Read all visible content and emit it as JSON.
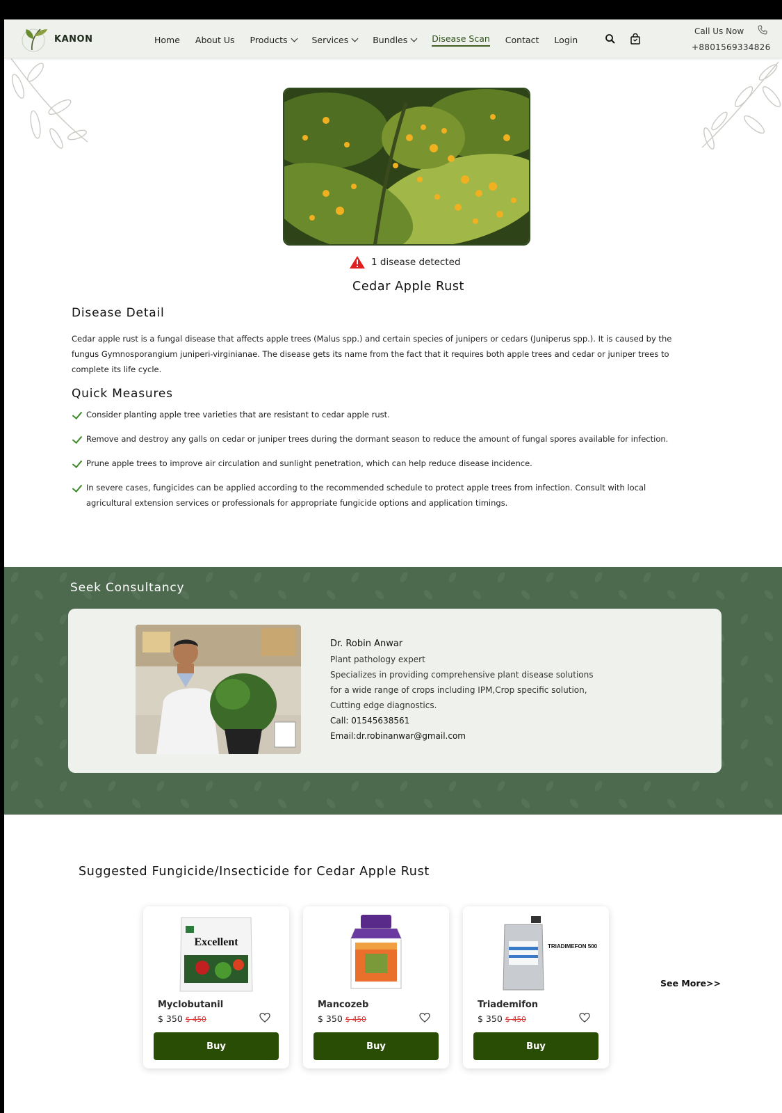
{
  "brand": {
    "name": "KANON"
  },
  "nav": {
    "items": [
      {
        "label": "Home"
      },
      {
        "label": "About Us"
      },
      {
        "label": "Products"
      },
      {
        "label": "Services"
      },
      {
        "label": "Bundles"
      },
      {
        "label": "Disease Scan"
      },
      {
        "label": "Contact"
      },
      {
        "label": "Login"
      }
    ],
    "active": "Disease Scan"
  },
  "header": {
    "call_label": "Call Us Now",
    "phone": "+8801569334826"
  },
  "scan": {
    "detected_text": "1 disease detected",
    "disease_name": "Cedar Apple Rust"
  },
  "detail": {
    "heading": "Disease Detail",
    "text": "Cedar apple rust is a fungal disease that affects apple trees (Malus spp.) and certain species of junipers or cedars (Juniperus spp.). It is caused by the fungus Gymnosporangium juniperi-virginianae. The disease gets its name from the fact that it requires both apple trees and cedar or juniper trees to complete its life cycle."
  },
  "measures": {
    "heading": "Quick Measures",
    "items": [
      "Consider planting apple tree varieties that are resistant to cedar apple rust.",
      "Remove and destroy any galls on cedar or juniper trees during the dormant season to reduce the amount of fungal spores available for infection.",
      "Prune apple trees to improve air circulation and sunlight penetration, which can help reduce disease incidence.",
      "In severe cases, fungicides can be applied according to the recommended schedule to protect apple trees from infection. Consult with local agricultural extension services or professionals for appropriate fungicide options and application timings."
    ]
  },
  "consultancy": {
    "heading": "Seek Consultancy",
    "name": "Dr. Robin Anwar",
    "role": "Plant pathology expert",
    "desc1": "Specializes in providing comprehensive plant disease solutions",
    "desc2": "for a wide range of crops including IPM,Crop specific solution,",
    "desc3": "Cutting edge diagnostics.",
    "call": "Call: 01545638561",
    "email": "Email:dr.robinanwar@gmail.com"
  },
  "suggested": {
    "heading": "Suggested Fungicide/Insecticide for Cedar Apple Rust",
    "products": [
      {
        "name": "Myclobutanil",
        "price": "$ 350",
        "old_price": "$ 450",
        "buy": "Buy",
        "package_text": "Excellent"
      },
      {
        "name": "Mancozeb",
        "price": "$ 350",
        "old_price": "$ 450",
        "buy": "Buy",
        "package_text": ""
      },
      {
        "name": "Triademifon",
        "price": "$ 350",
        "old_price": "$ 450",
        "buy": "Buy",
        "package_text": "TRIADIMEFON 500 WG"
      }
    ],
    "see_more": "See More>>"
  },
  "colors": {
    "brand_green": "#2a4d06",
    "consult_bg": "#4d6a4f",
    "header_bg": "#eef1ec",
    "check_green": "#3e8a2a",
    "warning_red": "#e02020"
  },
  "icons": [
    "search-icon",
    "bag-icon",
    "phone-icon",
    "warning-icon",
    "check-icon",
    "heart-icon",
    "chevron-down-icon"
  ]
}
